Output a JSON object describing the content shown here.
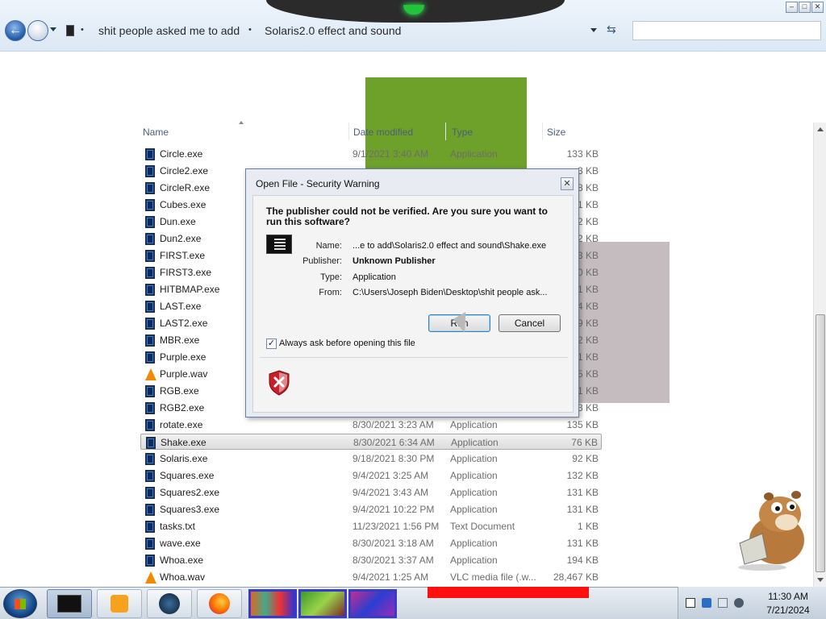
{
  "explorer": {
    "breadcrumb": [
      "shit people asked me to add",
      "Solaris2.0 effect and sound"
    ],
    "breadcrumb_sep": "•",
    "search_placeholder": "",
    "columns": {
      "name": "Name",
      "date": "Date modified",
      "type": "Type",
      "size": "Size"
    },
    "files": [
      {
        "name": "Circle.exe",
        "date": "9/1/2021 3:40 AM",
        "type": "Application",
        "size": "133 KB",
        "icon": "exe-icon"
      },
      {
        "name": "Circle2.exe",
        "date": "",
        "type": "",
        "size": "3 KB",
        "icon": "exe-icon"
      },
      {
        "name": "CircleR.exe",
        "date": "",
        "type": "",
        "size": "8 KB",
        "icon": "exe-icon"
      },
      {
        "name": "Cubes.exe",
        "date": "",
        "type": "",
        "size": "1 KB",
        "icon": "exe-icon"
      },
      {
        "name": "Dun.exe",
        "date": "",
        "type": "",
        "size": "2 KB",
        "icon": "exe-icon"
      },
      {
        "name": "Dun2.exe",
        "date": "",
        "type": "",
        "size": "2 KB",
        "icon": "exe-icon"
      },
      {
        "name": "FIRST.exe",
        "date": "",
        "type": "",
        "size": "3 KB",
        "icon": "exe-icon"
      },
      {
        "name": "FIRST3.exe",
        "date": "",
        "type": "",
        "size": "0 KB",
        "icon": "exe-icon"
      },
      {
        "name": "HITBMAP.exe",
        "date": "",
        "type": "",
        "size": "1 KB",
        "icon": "exe-icon"
      },
      {
        "name": "LAST.exe",
        "date": "",
        "type": "",
        "size": "4 KB",
        "icon": "exe-icon"
      },
      {
        "name": "LAST2.exe",
        "date": "",
        "type": "",
        "size": "9 KB",
        "icon": "exe-icon"
      },
      {
        "name": "MBR.exe",
        "date": "",
        "type": "",
        "size": "2 KB",
        "icon": "exe-icon"
      },
      {
        "name": "Purple.exe",
        "date": "",
        "type": "",
        "size": "1 KB",
        "icon": "exe-icon"
      },
      {
        "name": "Purple.wav",
        "date": "",
        "type": "",
        "size": "5 KB",
        "icon": "vlc-icon"
      },
      {
        "name": "RGB.exe",
        "date": "",
        "type": "",
        "size": "1 KB",
        "icon": "exe-icon"
      },
      {
        "name": "RGB2.exe",
        "date": "",
        "type": "",
        "size": "3 KB",
        "icon": "exe-icon"
      },
      {
        "name": "rotate.exe",
        "date": "8/30/2021 3:23 AM",
        "type": "Application",
        "size": "135 KB",
        "icon": "exe-icon"
      },
      {
        "name": "Shake.exe",
        "date": "8/30/2021 6:34 AM",
        "type": "Application",
        "size": "76 KB",
        "icon": "exe-icon",
        "selected": true
      },
      {
        "name": "Solaris.exe",
        "date": "9/18/2021 8:30 PM",
        "type": "Application",
        "size": "92 KB",
        "icon": "exe-icon"
      },
      {
        "name": "Squares.exe",
        "date": "9/4/2021 3:25 AM",
        "type": "Application",
        "size": "132 KB",
        "icon": "exe-icon"
      },
      {
        "name": "Squares2.exe",
        "date": "9/4/2021 3:43 AM",
        "type": "Application",
        "size": "131 KB",
        "icon": "exe-icon"
      },
      {
        "name": "Squares3.exe",
        "date": "9/4/2021 10:22 PM",
        "type": "Application",
        "size": "131 KB",
        "icon": "exe-icon"
      },
      {
        "name": "tasks.txt",
        "date": "11/23/2021 1:56 PM",
        "type": "Text Document",
        "size": "1 KB",
        "icon": "exe-icon"
      },
      {
        "name": "wave.exe",
        "date": "8/30/2021 3:18 AM",
        "type": "Application",
        "size": "131 KB",
        "icon": "exe-icon"
      },
      {
        "name": "Whoa.exe",
        "date": "8/30/2021 3:37 AM",
        "type": "Application",
        "size": "194 KB",
        "icon": "exe-icon"
      },
      {
        "name": "Whoa.wav",
        "date": "9/4/2021 1:25 AM",
        "type": "VLC media file (.w...",
        "size": "28,467 KB",
        "icon": "vlc-icon"
      }
    ]
  },
  "dialog": {
    "title": "Open File - Security Warning",
    "heading": "The publisher could not be verified.  Are you sure you want to run this software?",
    "name_label": "Name:",
    "name_value": "...e to add\\Solaris2.0 effect and sound\\Shake.exe",
    "publisher_label": "Publisher:",
    "publisher_value": "Unknown Publisher",
    "type_label": "Type:",
    "type_value": "Application",
    "from_label": "From:",
    "from_value": "C:\\Users\\Joseph Biden\\Desktop\\shit people ask...",
    "run_label": "Run",
    "cancel_label": "Cancel",
    "checkbox_label": "Always ask before opening this file",
    "checkbox_checked": true,
    "close_glyph": "✕",
    "check_glyph": "✓"
  },
  "window_controls": {
    "minimize": "–",
    "maximize": "□",
    "close": "✕"
  },
  "taskbar": {
    "time": "11:30 AM",
    "date": "7/21/2024"
  },
  "colors": {
    "accent": "#1f5aa6",
    "green_block": "#6ea12a",
    "gray_block": "#c4bcbf",
    "red_bar": "#ff0f0f"
  }
}
